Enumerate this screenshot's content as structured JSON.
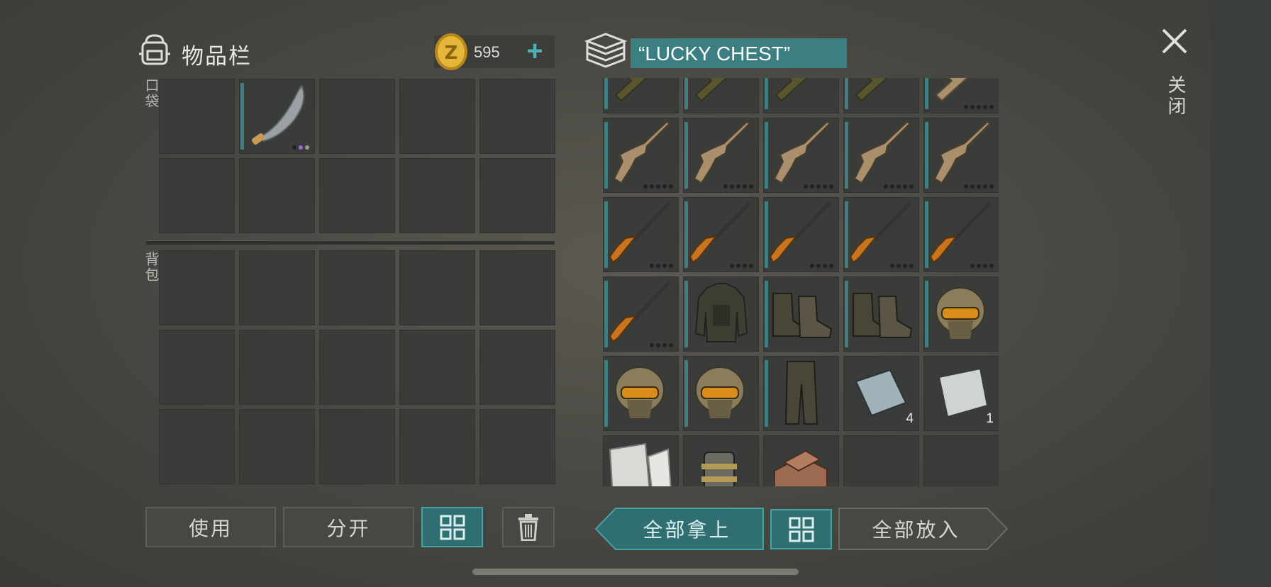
{
  "inventory": {
    "title": "物品栏",
    "coins": "595",
    "add_label": "+"
  },
  "pocket": {
    "label": "口袋"
  },
  "backpack": {
    "label": "背包"
  },
  "chest": {
    "title": "“LUCKY CHEST”"
  },
  "close": {
    "label": "关闭"
  },
  "buttons": {
    "use": "使用",
    "split": "分开",
    "take_all": "全部拿上",
    "put_all": "全部放入"
  },
  "chest_counts": {
    "plate_a": "4",
    "plate_b": "1"
  },
  "colors": {
    "accent": "#3b7f82",
    "teal_icon": "#4fb1b3",
    "coin": "#d4a526"
  }
}
